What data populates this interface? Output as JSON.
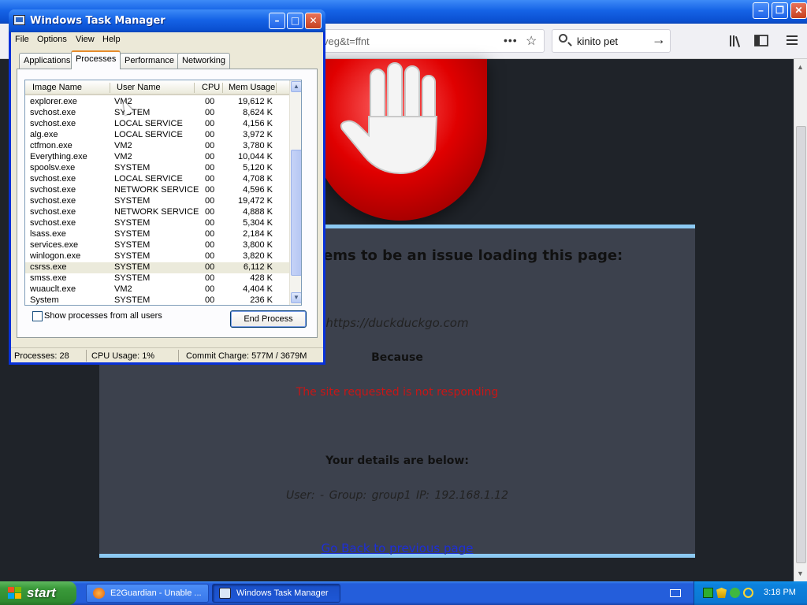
{
  "firefox": {
    "url_fragment": "veg&t=ffnt",
    "url_more": "•••",
    "search_value": "kinito pet",
    "block_page": {
      "issue_heading": "ems to be an issue loading this page:",
      "blocked_url": "https://duckduckgo.com",
      "because_label": "Because",
      "reason": "The site requested is not responding",
      "details_heading": "Your details are below:",
      "user_line": "User: -    Group: group1    IP: 192.168.1.12",
      "go_back_link": "Go Back to previous page"
    }
  },
  "task_manager": {
    "title": "Windows Task Manager",
    "menu": [
      "File",
      "Options",
      "View",
      "Help"
    ],
    "tabs": [
      "Applications",
      "Processes",
      "Performance",
      "Networking"
    ],
    "active_tab": "Processes",
    "columns": [
      "Image Name",
      "User Name",
      "CPU",
      "Mem Usage"
    ],
    "processes": [
      {
        "image": "explorer.exe",
        "user": "VM2",
        "cpu": "00",
        "mem": "19,612 K"
      },
      {
        "image": "svchost.exe",
        "user": "SYSTEM",
        "cpu": "00",
        "mem": "8,624 K"
      },
      {
        "image": "svchost.exe",
        "user": "LOCAL SERVICE",
        "cpu": "00",
        "mem": "4,156 K"
      },
      {
        "image": "alg.exe",
        "user": "LOCAL SERVICE",
        "cpu": "00",
        "mem": "3,972 K"
      },
      {
        "image": "ctfmon.exe",
        "user": "VM2",
        "cpu": "00",
        "mem": "3,780 K"
      },
      {
        "image": "Everything.exe",
        "user": "VM2",
        "cpu": "00",
        "mem": "10,044 K"
      },
      {
        "image": "spoolsv.exe",
        "user": "SYSTEM",
        "cpu": "00",
        "mem": "5,120 K"
      },
      {
        "image": "svchost.exe",
        "user": "LOCAL SERVICE",
        "cpu": "00",
        "mem": "4,708 K"
      },
      {
        "image": "svchost.exe",
        "user": "NETWORK SERVICE",
        "cpu": "00",
        "mem": "4,596 K"
      },
      {
        "image": "svchost.exe",
        "user": "SYSTEM",
        "cpu": "00",
        "mem": "19,472 K"
      },
      {
        "image": "svchost.exe",
        "user": "NETWORK SERVICE",
        "cpu": "00",
        "mem": "4,888 K"
      },
      {
        "image": "svchost.exe",
        "user": "SYSTEM",
        "cpu": "00",
        "mem": "5,304 K"
      },
      {
        "image": "lsass.exe",
        "user": "SYSTEM",
        "cpu": "00",
        "mem": "2,184 K"
      },
      {
        "image": "services.exe",
        "user": "SYSTEM",
        "cpu": "00",
        "mem": "3,800 K"
      },
      {
        "image": "winlogon.exe",
        "user": "SYSTEM",
        "cpu": "00",
        "mem": "3,820 K"
      },
      {
        "image": "csrss.exe",
        "user": "SYSTEM",
        "cpu": "00",
        "mem": "6,112 K",
        "selected": true
      },
      {
        "image": "smss.exe",
        "user": "SYSTEM",
        "cpu": "00",
        "mem": "428 K"
      },
      {
        "image": "wuauclt.exe",
        "user": "VM2",
        "cpu": "00",
        "mem": "4,404 K"
      },
      {
        "image": "System",
        "user": "SYSTEM",
        "cpu": "00",
        "mem": "236 K"
      }
    ],
    "show_all_label": "Show processes from all users",
    "show_all_checked": false,
    "end_process_label": "End Process",
    "status": {
      "processes": "Processes: 28",
      "cpu_usage": "CPU Usage: 1%",
      "commit_charge": "Commit Charge: 577M / 3679M"
    }
  },
  "taskbar": {
    "start_label": "start",
    "buttons": [
      {
        "label": "E2Guardian - Unable ...",
        "active": false
      },
      {
        "label": "Windows Task Manager",
        "active": true
      }
    ],
    "clock": "3:18 PM"
  }
}
